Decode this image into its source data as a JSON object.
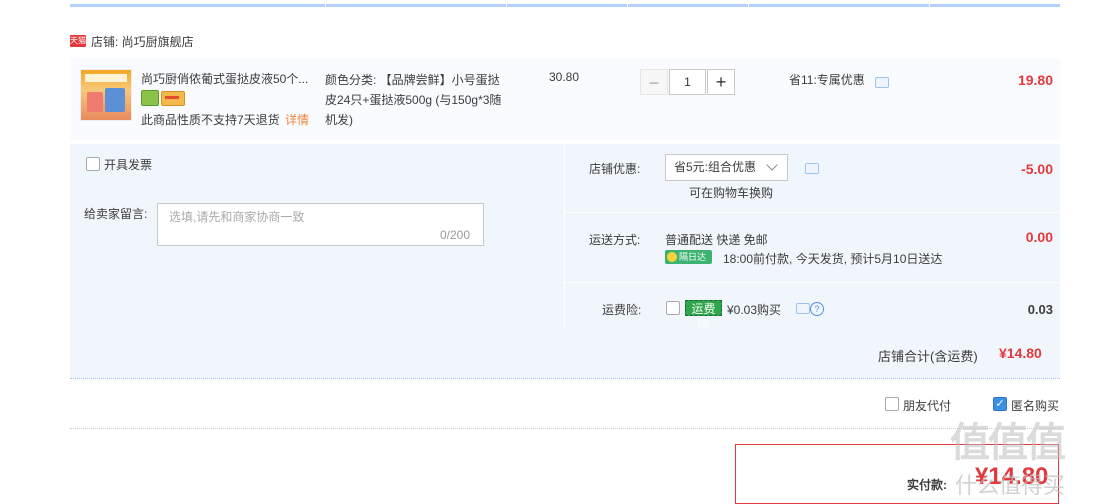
{
  "shop": {
    "badge": "天猫",
    "name": "店铺: 尚巧厨旗舰店"
  },
  "item": {
    "title": "尚巧厨俏侬葡式蛋挞皮液50个...",
    "returns_note": "此商品性质不支持7天退货",
    "detail_link": "详情",
    "sku": "颜色分类: 【品牌尝鲜】小号蛋挞皮24只+蛋挞液500g (与150g*3随机发)",
    "unit_price": "30.80",
    "quantity": "1",
    "minus": "−",
    "plus": "+",
    "promo": "省11:专属优惠",
    "subtotal": "19.80"
  },
  "invoice": {
    "label": "开具发票"
  },
  "message": {
    "label": "给卖家留言:",
    "placeholder": "选填,请先和商家协商一致",
    "count": "0/200"
  },
  "discount": {
    "label": "店铺优惠:",
    "selected": "省5元:组合优惠",
    "hint": "可在购物车换购",
    "value": "-5.00"
  },
  "shipping": {
    "label": "运送方式:",
    "method": "普通配送 快递 免邮",
    "badge": "隔日达",
    "eta": "18:00前付款, 今天发货, 预计5月10日送达",
    "value": "0.00"
  },
  "insurance": {
    "label": "运费险:",
    "badge": "运费险",
    "price": "¥0.03购买",
    "help": "?",
    "value": "0.03"
  },
  "shop_total": {
    "label": "店铺合计(含运费)",
    "value": "¥14.80"
  },
  "options": {
    "friend_pay": "朋友代付",
    "anonymous": "匿名购买",
    "check": "✓"
  },
  "payment": {
    "label": "实付款:",
    "value": "¥14.80"
  },
  "watermark": {
    "big": "值值值",
    "small": "什么值得买"
  }
}
